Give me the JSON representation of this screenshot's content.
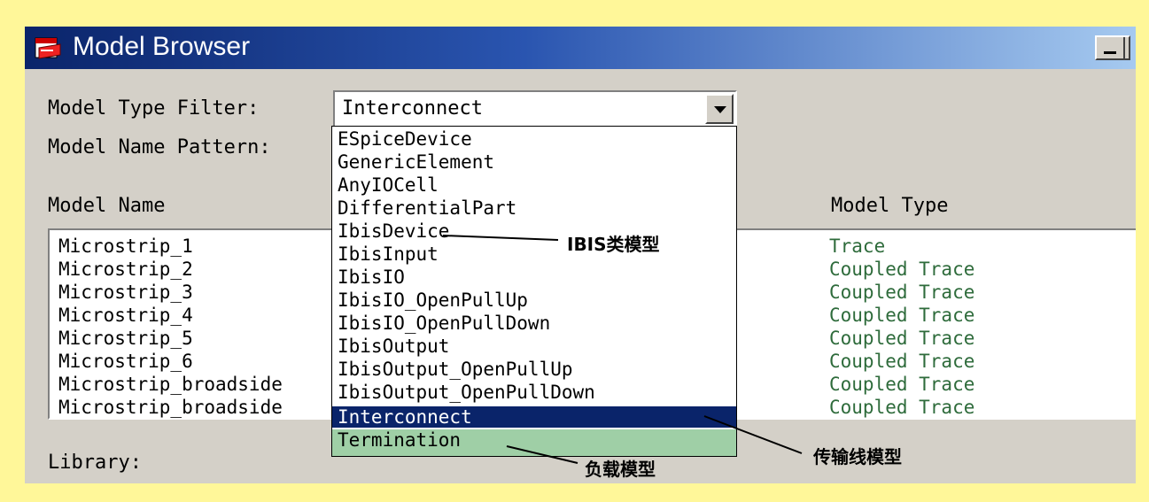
{
  "window": {
    "title": "Model Browser",
    "icon": "model-browser-app-icon"
  },
  "filters": {
    "type_label": "Model Type Filter:",
    "type_value": "Interconnect",
    "name_label": "Model Name Pattern:"
  },
  "columns": {
    "model_name": "Model Name",
    "model_type": "Model Type"
  },
  "rows": [
    {
      "name": "Microstrip_1",
      "type": "Trace"
    },
    {
      "name": "Microstrip_2",
      "type": "Coupled Trace"
    },
    {
      "name": "Microstrip_3",
      "type": "Coupled Trace"
    },
    {
      "name": "Microstrip_4",
      "type": "Coupled Trace"
    },
    {
      "name": "Microstrip_5",
      "type": "Coupled Trace"
    },
    {
      "name": "Microstrip_6",
      "type": "Coupled Trace"
    },
    {
      "name": "Microstrip_broadside",
      "type": "Coupled Trace"
    },
    {
      "name": "Microstrip_broadside",
      "type": "Coupled Trace"
    }
  ],
  "library_label": "Library:",
  "dropdown": {
    "options": [
      "ESpiceDevice",
      "GenericElement",
      "AnyIOCell",
      "DifferentialPart",
      "IbisDevice",
      "IbisInput",
      "IbisIO",
      "IbisIO_OpenPullUp",
      "IbisIO_OpenPullDown",
      "IbisOutput",
      "IbisOutput_OpenPullUp",
      "IbisOutput_OpenPullDown",
      "Interconnect",
      "Termination"
    ],
    "selected": "Interconnect",
    "highlighted": "Termination"
  },
  "annotations": {
    "ibis": "IBIS类模型",
    "transmission": "传输线模型",
    "load": "负载模型"
  },
  "colors": {
    "frame": "#fff799",
    "title_bar": "#0a246a",
    "selected_bg": "#0a246a",
    "highlight_bg": "#9fcfa6",
    "type_text": "#2e6b3b"
  }
}
